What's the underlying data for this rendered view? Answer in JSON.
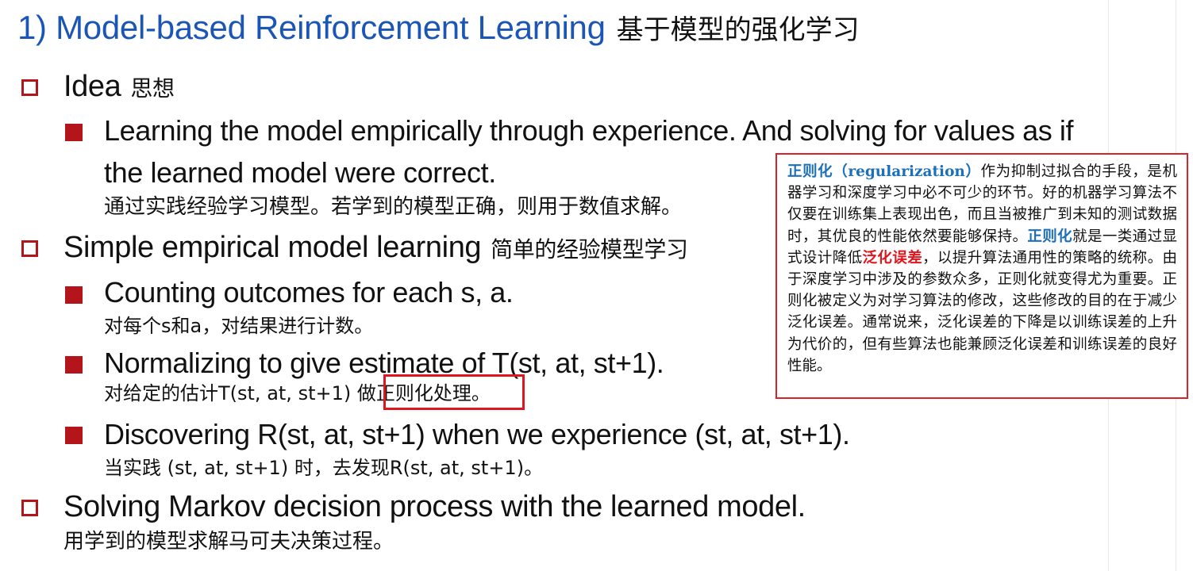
{
  "title": {
    "en": "1) Model-based Reinforcement Learning",
    "zh": "基于模型的强化学习"
  },
  "sections": [
    {
      "heading": "Idea",
      "heading_zh": "思想",
      "bullets": [
        {
          "lines": [
            "Learning the model empirically through experience. And solving for values as if",
            "the learned model were correct."
          ],
          "zh": "通过实践经验学习模型。若学到的模型正确，则用于数值求解。"
        }
      ]
    },
    {
      "heading": "Simple empirical model learning",
      "heading_zh": "简单的经验模型学习",
      "bullets": [
        {
          "text": "Counting outcomes for each s, a.",
          "zh": "对每个s和a，对结果进行计数。"
        },
        {
          "text": "Normalizing to give estimate of T(st, at, st+1).",
          "zh_before": "对给定的估计T(st, at, st+1) 做",
          "zh_highlight": "正则化处理。"
        },
        {
          "text": "Discovering R(st, at, st+1) when we experience (st, at, st+1).",
          "zh": "当实践 (st, at, st+1) 时，去发现R(st, at, st+1)。"
        }
      ]
    },
    {
      "heading": "Solving Markov decision process with the learned model.",
      "zh": "用学到的模型求解马可夫决策过程。"
    }
  ],
  "annotation": {
    "part1_blue": "正则化（regularization）",
    "part2": "作为抑制过拟合的手段，是机器学习和深度学习中必不可少的环节。好的机器学习算法不仅要在训练集上表现出色，而且当被推广到未知的测试数据时，其优良的性能依然要能够保持。",
    "part3_blue": "正则化",
    "part4": "就是一类通过显式设计降低",
    "part5_red": "泛化误差",
    "part6": "，以提升算法通用性的策略的统称。由于深度学习中涉及的参数众多，正则化就变得尤为重要。正则化被定义为对学习算法的修改，这些修改的目的在于减少泛化误差。通常说来，泛化误差的下降是以训练误差的上升为代价的，但有些算法也能兼顾泛化误差和训练误差的良好性能。"
  },
  "colors": {
    "title_blue": "#1b55b5",
    "bullet_red": "#b3151b",
    "highlight_red": "#e0161e",
    "note_blue": "#1c6fb9"
  }
}
